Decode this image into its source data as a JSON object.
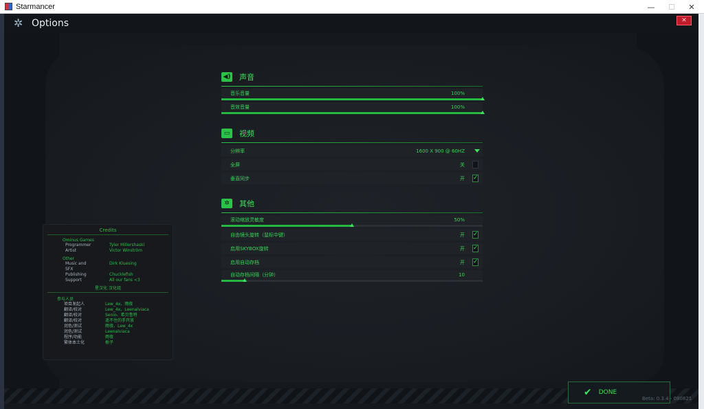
{
  "window": {
    "title": "Starmancer",
    "minimize": "—",
    "maximize": "☐",
    "close": "✕"
  },
  "header": {
    "title": "Options",
    "exit_label": "✕"
  },
  "sections": {
    "audio": {
      "title": "声音",
      "icon": "speaker-icon",
      "rows": [
        {
          "label": "音乐音量",
          "value": "100%",
          "percent": 100
        },
        {
          "label": "音效音量",
          "value": "100%",
          "percent": 100
        }
      ]
    },
    "video": {
      "title": "视频",
      "icon": "monitor-icon",
      "resolution": {
        "label": "分辨率",
        "value": "1600 X 900 @ 60HZ"
      },
      "fullscreen": {
        "label": "全屏",
        "value": "关",
        "checked": false
      },
      "vsync": {
        "label": "垂直同步",
        "value": "开",
        "checked": true
      }
    },
    "other": {
      "title": "其他",
      "icon": "gear-icon",
      "scroll": {
        "label": "滚动缩放灵敏度",
        "value": "50%",
        "percent": 50
      },
      "camera": {
        "label": "自由镜头旋转（鼠标中键）",
        "value": "开",
        "checked": true
      },
      "skybox": {
        "label": "启用SKYBOX旋转",
        "value": "开",
        "checked": true
      },
      "autosave": {
        "label": "启用自动存档",
        "value": "开",
        "checked": true
      },
      "interval": {
        "label": "自动存档间隔（分钟）",
        "value": "10",
        "percent": 9
      }
    }
  },
  "credits": {
    "title": "Credits",
    "group1": "Ominus Games",
    "group1_rows": [
      {
        "role": "Programmer",
        "who": "Tyler Millershaski"
      },
      {
        "role": "Artist",
        "who": "Victor Winström"
      }
    ],
    "group2": "Other",
    "group2_rows": [
      {
        "role": "Music and SFX",
        "who": "Dirk Kluesing"
      },
      {
        "role": "Publishing",
        "who": "Chucklefish"
      },
      {
        "role": "Support",
        "who": "All our fans <3"
      }
    ],
    "localization": "星汉化 汉化组",
    "group3": "参与人员",
    "group3_rows": [
      {
        "role": "项目发起人",
        "who": "Lew_4x、雨夜"
      },
      {
        "role": "翻译/校对",
        "who": "Lew_4x、Leenalviaca"
      },
      {
        "role": "翻译/校对",
        "who": "Senio、希贝鲁特"
      },
      {
        "role": "翻译/校对",
        "who": "遥不住的手开放"
      },
      {
        "role": "润色/测试",
        "who": "雨夜、Lew_4x"
      },
      {
        "role": "润色/测试",
        "who": "Leenalviaca"
      },
      {
        "role": "程序/功能",
        "who": "雨夜"
      },
      {
        "role": "繁体本土化",
        "who": "栀子"
      }
    ]
  },
  "done": {
    "label": "DONE"
  },
  "build": "Beta: 0.3.4 - 080821"
}
